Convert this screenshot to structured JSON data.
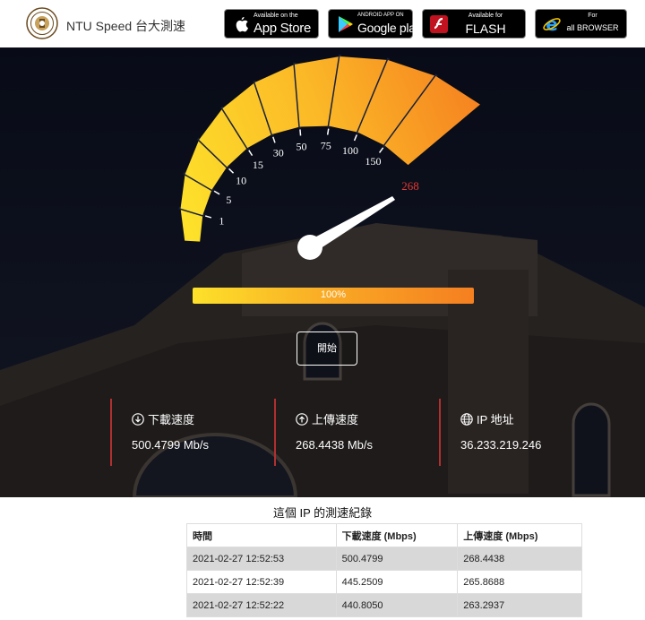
{
  "header": {
    "brand": "NTU Speed 台大測速",
    "stores": [
      {
        "small": "Available on the",
        "big": "App Store",
        "icon": "apple-icon"
      },
      {
        "small": "ANDROID APP ON",
        "big": "Google play",
        "icon": "google-play-icon"
      },
      {
        "small": "Available for",
        "big": "FLASH",
        "icon": "flash-icon"
      },
      {
        "small": "For",
        "big": "all BROWSER",
        "icon": "ie-icon"
      }
    ]
  },
  "gauge": {
    "ticks": [
      "1",
      "5",
      "10",
      "15",
      "30",
      "50",
      "75",
      "100",
      "150"
    ],
    "current_value": "268",
    "colors": {
      "start": "#fde12a",
      "end": "#f57f20",
      "value": "#e53935"
    }
  },
  "progress": {
    "label": "100%",
    "percent": 100
  },
  "start_button": "開始",
  "stats": {
    "download": {
      "label": "下載速度",
      "value": "500.4799 Mb/s",
      "icon": "download-icon"
    },
    "upload": {
      "label": "上傳速度",
      "value": "268.4438 Mb/s",
      "icon": "upload-icon"
    },
    "ip": {
      "label": "IP 地址",
      "value": "36.233.219.246",
      "icon": "globe-icon"
    }
  },
  "history": {
    "title": "這個 IP 的測速紀錄",
    "columns": [
      "時間",
      "下載速度 (Mbps)",
      "上傳速度 (Mbps)"
    ],
    "rows": [
      [
        "2021-02-27 12:52:53",
        "500.4799",
        "268.4438"
      ],
      [
        "2021-02-27 12:52:39",
        "445.2509",
        "265.8688"
      ],
      [
        "2021-02-27 12:52:22",
        "440.8050",
        "263.2937"
      ]
    ]
  }
}
